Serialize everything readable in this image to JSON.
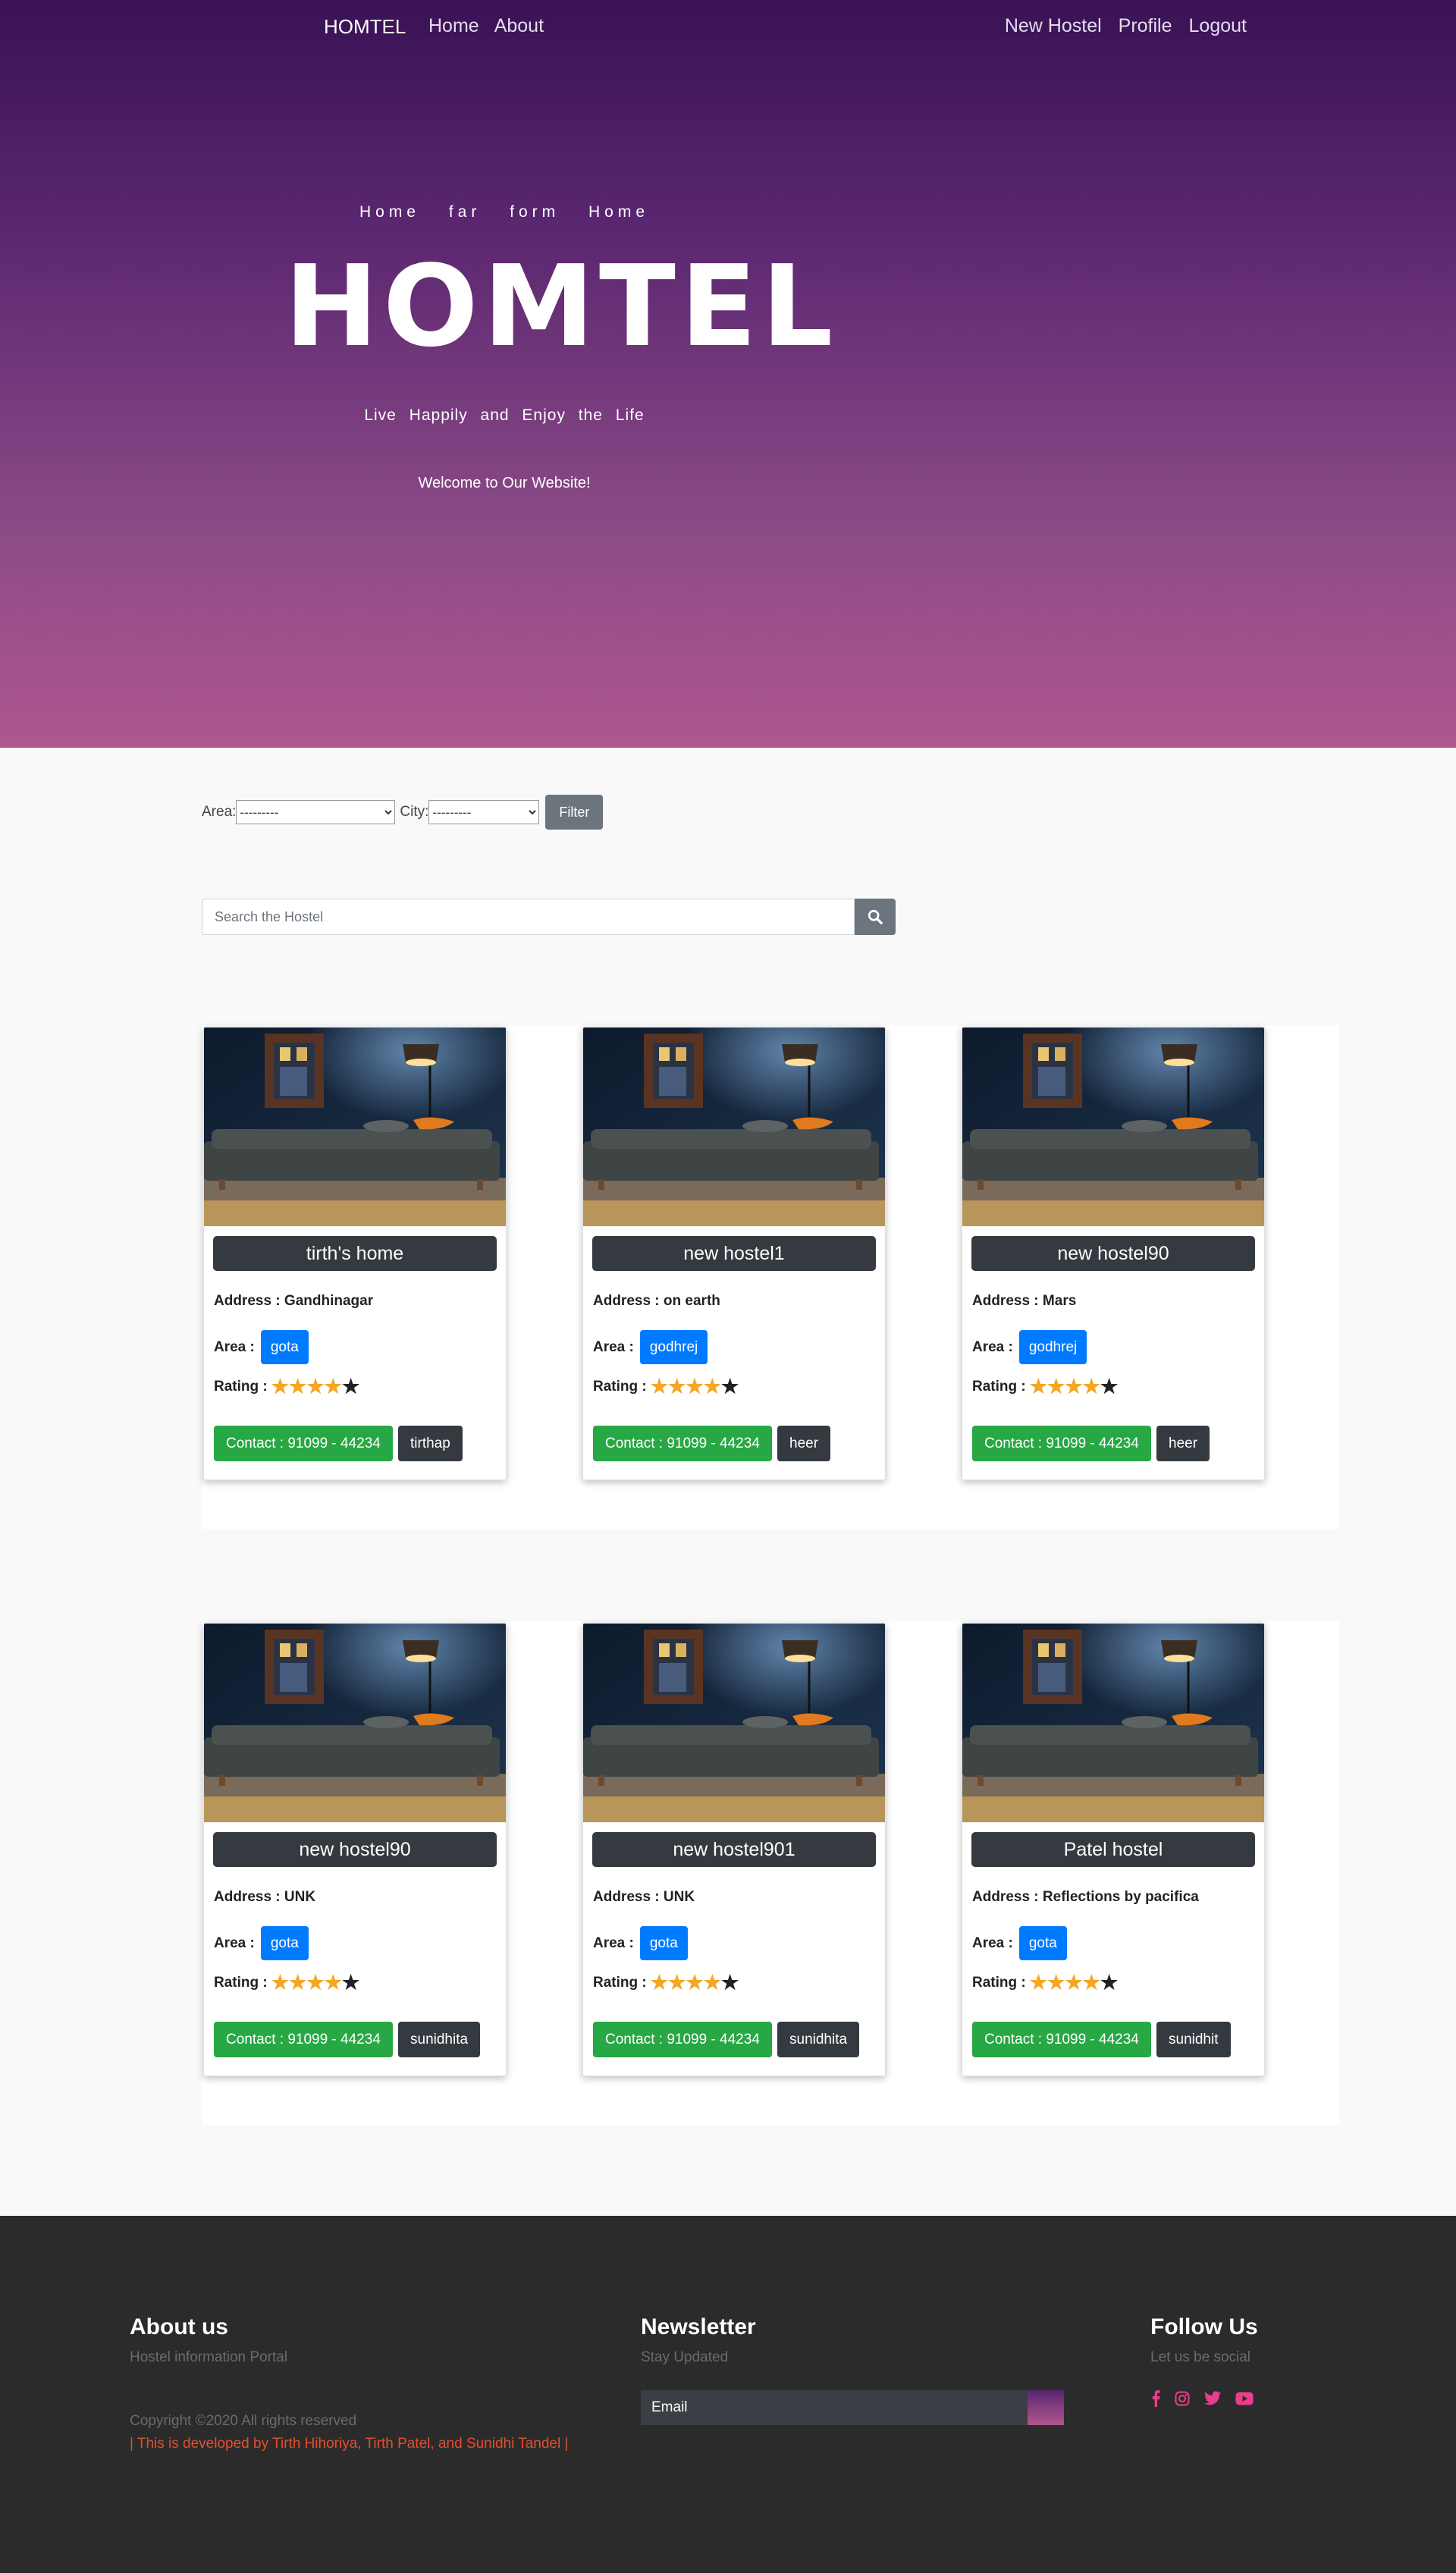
{
  "nav": {
    "brand": "HOMTEL",
    "left": [
      "Home",
      "About"
    ],
    "right": [
      "New Hostel",
      "Profile",
      "Logout"
    ]
  },
  "hero": {
    "tagline_top": "Home far form Home",
    "title": "HOMTEL",
    "tagline_mid": "Live Happily and Enjoy the Life",
    "welcome": "Welcome to Our Website!"
  },
  "filter": {
    "area_label": "Area:",
    "area_value": "---------",
    "city_label": "City:",
    "city_value": "---------",
    "button": "Filter"
  },
  "search": {
    "placeholder": "Search the Hostel",
    "icon": "search-icon"
  },
  "card_labels": {
    "address": "Address : ",
    "area": "Area :",
    "rating": "Rating :",
    "contact": "Contact : 91099 - 44234"
  },
  "cards": [
    {
      "name": "tirth's home",
      "address": "Gandhinagar",
      "area": "gota",
      "rating": 4,
      "owner": "tirthap"
    },
    {
      "name": "new hostel1",
      "address": "on earth",
      "area": "godhrej",
      "rating": 4,
      "owner": "heer"
    },
    {
      "name": "new hostel90",
      "address": "Mars",
      "area": "godhrej",
      "rating": 4,
      "owner": "heer"
    },
    {
      "name": "new hostel90",
      "address": "UNK",
      "area": "gota",
      "rating": 4,
      "owner": "sunidhita"
    },
    {
      "name": "new hostel901",
      "address": "UNK",
      "area": "gota",
      "rating": 4,
      "owner": "sunidhita"
    },
    {
      "name": "Patel hostel",
      "address": "Reflections by pacifica",
      "area": "gota",
      "rating": 4,
      "owner": "sunidhit"
    }
  ],
  "footer": {
    "about_title": "About us",
    "about_sub": "Hostel information Portal",
    "copyright": "Copyright ©2020 All rights reserved",
    "developed": "| This is developed by Tirth Hihoriya, Tirth Patel, and Sunidhi Tandel |",
    "news_title": "Newsletter",
    "news_sub": "Stay Updated",
    "news_placeholder": "Email",
    "follow_title": "Follow Us",
    "follow_sub": "Let us be social",
    "social_icons": [
      "facebook-icon",
      "instagram-icon",
      "twitter-icon",
      "youtube-icon"
    ]
  },
  "colors": {
    "brand_purple": "#3a1255",
    "brand_pink": "#b0568f",
    "badge_blue": "#007bff",
    "contact_green": "#28a745",
    "dark": "#343a40",
    "star": "#f5a623",
    "social_pink": "#e83e8c",
    "dev_red": "#e24f2d"
  }
}
